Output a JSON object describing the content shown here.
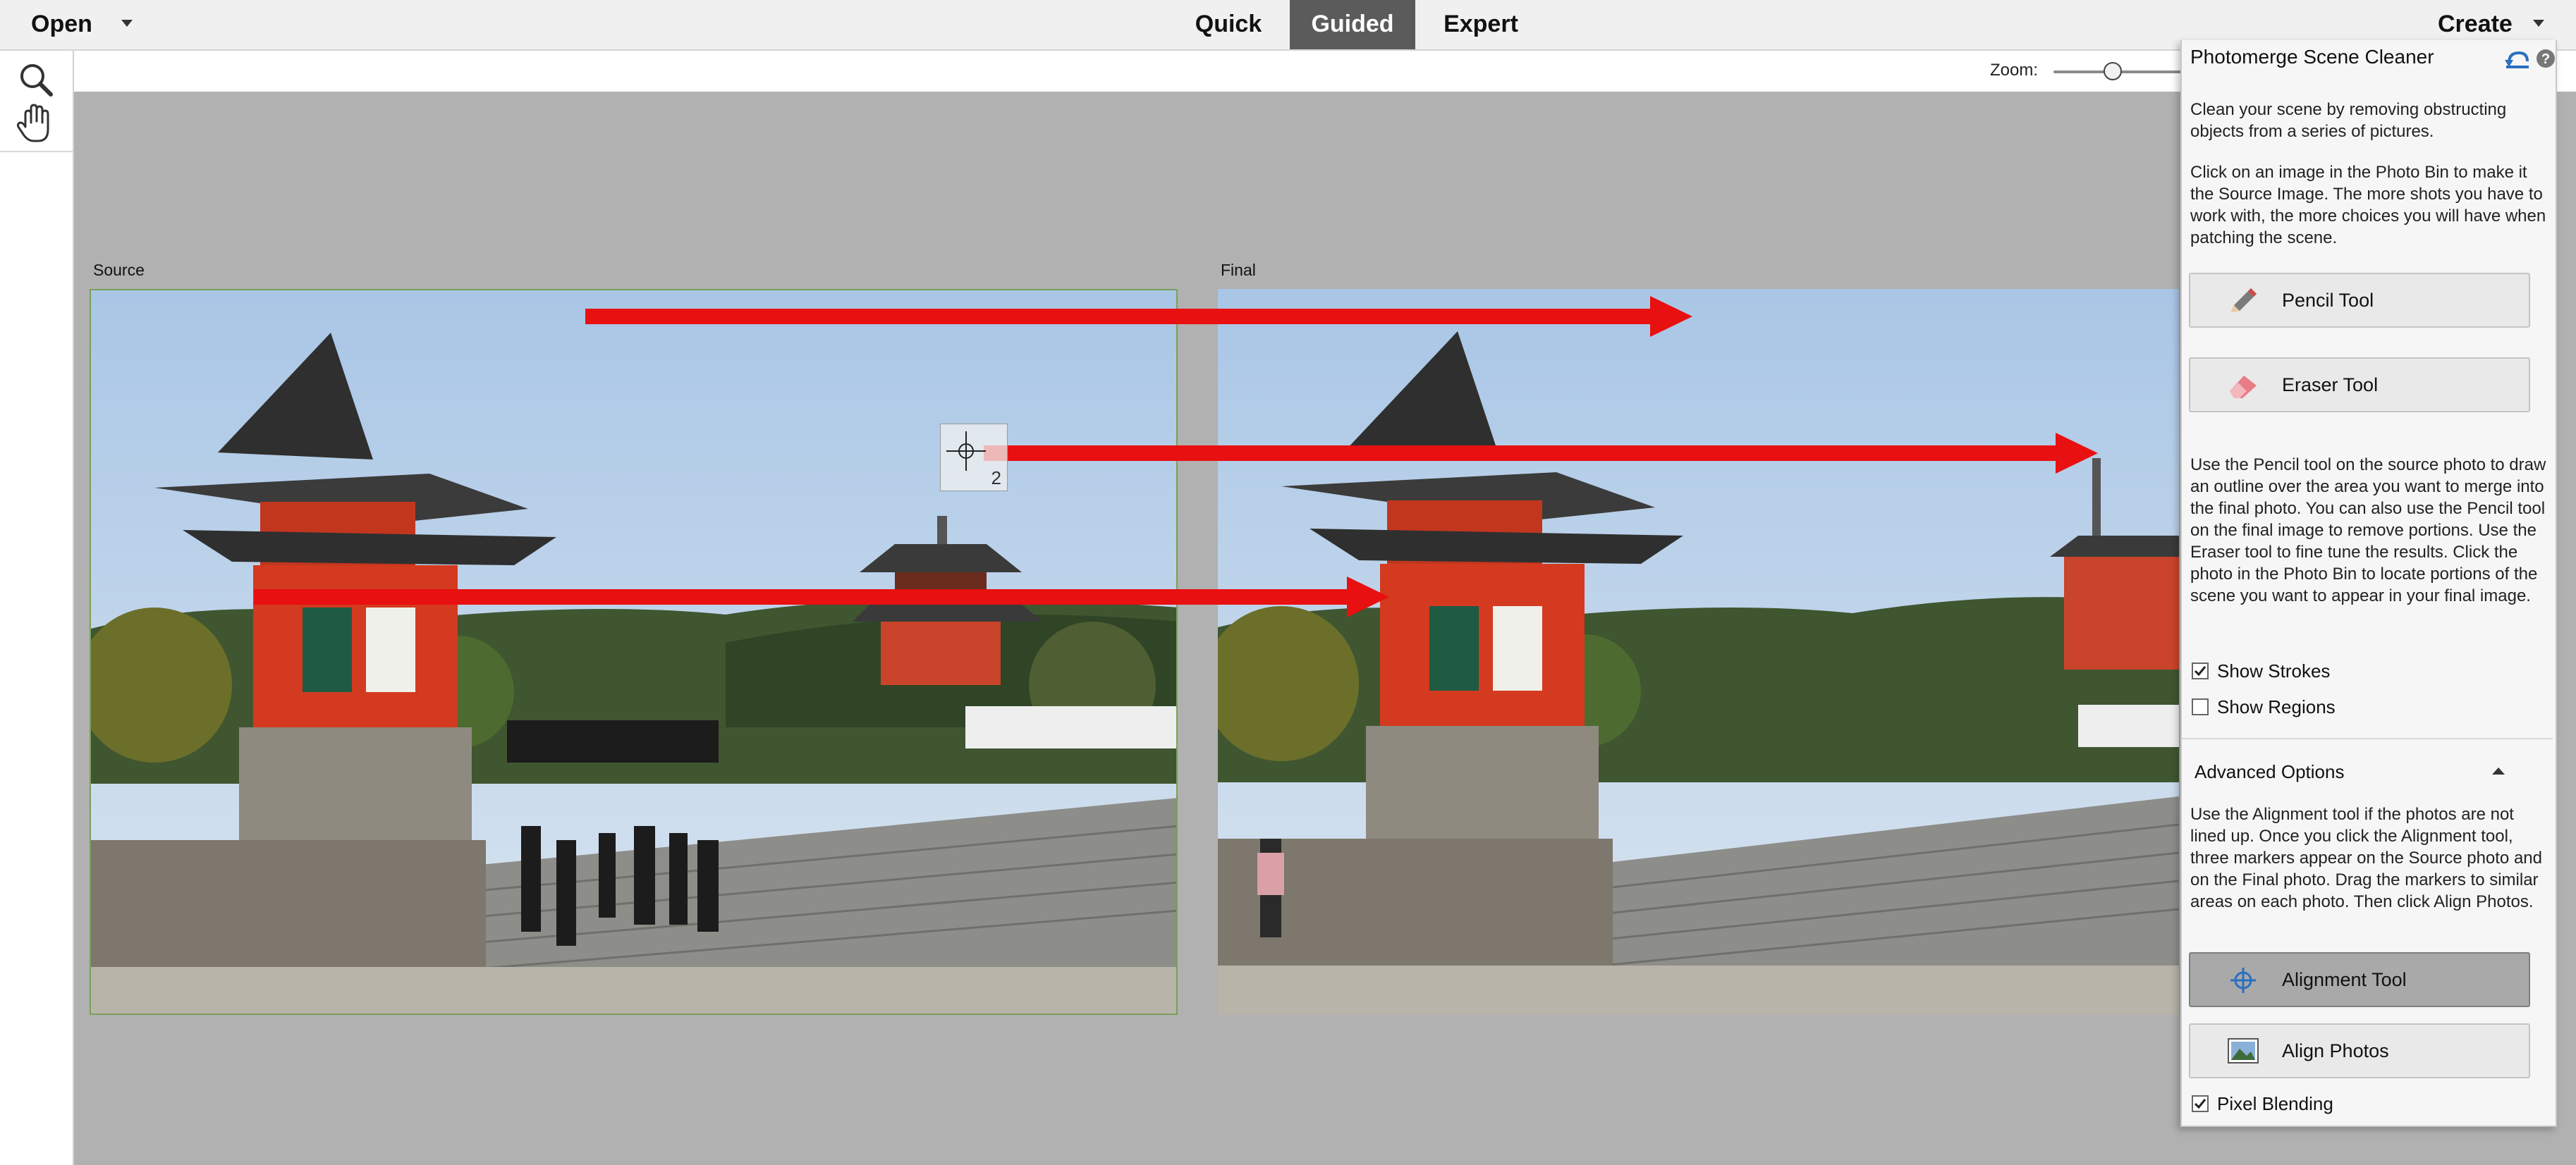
{
  "topbar": {
    "open_label": "Open",
    "create_label": "Create",
    "modes": [
      {
        "label": "Quick",
        "active": false
      },
      {
        "label": "Guided",
        "active": true
      },
      {
        "label": "Expert",
        "active": false
      }
    ]
  },
  "tools": [
    {
      "name": "zoom-tool",
      "icon": "magnifier-icon"
    },
    {
      "name": "hand-tool",
      "icon": "hand-icon"
    }
  ],
  "workspace": {
    "zoom_label": "Zoom:",
    "zoom_level": 0.44,
    "source_label": "Source",
    "final_label": "Final",
    "marker_number": "2"
  },
  "panel": {
    "title": "Photomerge Scene Cleaner",
    "intro_1": "Clean your scene by removing obstructing objects from a series of pictures.",
    "intro_2": "Click on an image in the Photo Bin to make it the Source Image. The more shots you have to work with, the more choices you will have when patching the scene.",
    "pencil_label": "Pencil Tool",
    "eraser_label": "Eraser Tool",
    "instructions": "Use the Pencil tool on the source photo to draw an outline over the area you want to merge into the final photo. You can also use the Pencil tool on the final image to remove portions. Use the Eraser tool to fine tune the results. Click the photo in the Photo Bin to locate portions of the scene you want to appear in your final image.",
    "show_strokes": {
      "label": "Show Strokes",
      "checked": true
    },
    "show_regions": {
      "label": "Show Regions",
      "checked": false
    },
    "advanced_label": "Advanced Options",
    "advanced_text": "Use the Alignment tool if the photos are not lined up. Once you click the Alignment tool, three markers appear on the Source photo and on the Final photo. Drag the markers to similar areas on each photo. Then click Align Photos.",
    "alignment_label": "Alignment Tool",
    "align_photos_label": "Align Photos",
    "pixel_blending": {
      "label": "Pixel Blending",
      "checked": true
    }
  },
  "colors": {
    "arrow": "#e81010",
    "temple_red": "#d43a1f",
    "sky": "#b8d2ec",
    "active_tab": "#5b5b5b"
  }
}
